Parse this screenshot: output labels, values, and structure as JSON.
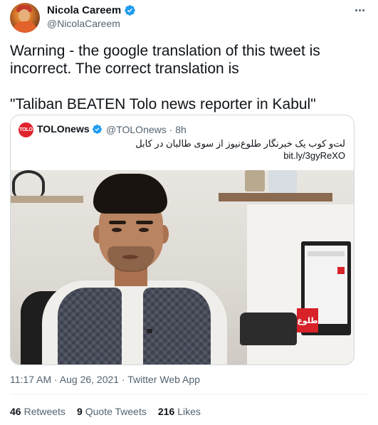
{
  "author": {
    "name": "Nicola Careem",
    "handle": "@NicolaCareem",
    "verified_icon": "verified-badge-icon",
    "avatar_icon": "avatar"
  },
  "tweet": {
    "line1": "Warning - the google translation of this tweet is incorrect.  The correct translation is",
    "line2": "\"Taliban BEATEN Tolo news reporter in Kabul\""
  },
  "quoted": {
    "avatar_text": "TOLO",
    "name": "TOLOnews",
    "handle_time": "@TOLOnews · 8h",
    "text": "لت‌و کوب یک خبرنگار طلوع‌نیوز از سوی طالبان در کابل",
    "link": "bit.ly/3gyReXO",
    "image_logo_text": "طلوع",
    "image_icon": "news-photo"
  },
  "meta": {
    "timestamp": "11:17 AM · Aug 26, 2021 · Twitter Web App"
  },
  "stats": {
    "retweets_count": "46",
    "retweets_label": "Retweets",
    "quotes_count": "9",
    "quotes_label": "Quote Tweets",
    "likes_count": "216",
    "likes_label": "Likes"
  },
  "colors": {
    "text": "#0f1419",
    "secondary": "#536471",
    "verified": "#1d9bf0",
    "border": "#cfd9de",
    "tolo_red": "#e0242e"
  }
}
